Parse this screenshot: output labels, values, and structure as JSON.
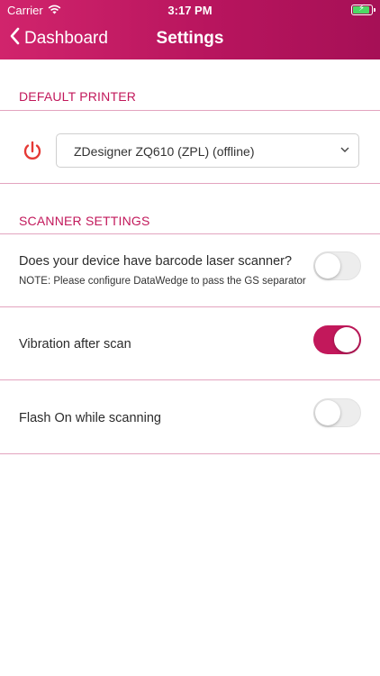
{
  "status_bar": {
    "carrier": "Carrier",
    "time": "3:17 PM",
    "wifi_icon": "wifi-icon",
    "battery_icon": "battery-charging-icon"
  },
  "nav": {
    "back_label": "Dashboard",
    "title": "Settings",
    "back_icon": "chevron-left-icon"
  },
  "printer": {
    "section_title": "DEFAULT PRINTER",
    "selected": "ZDesigner ZQ610 (ZPL) (offline)",
    "status_icon": "power-icon",
    "status_color": "#e53935"
  },
  "scanner": {
    "section_title": "SCANNER SETTINGS",
    "laser_label": "Does your device have barcode laser scanner?",
    "laser_note": "NOTE: Please configure DataWedge to pass the GS separator",
    "laser_enabled": false,
    "vibration_label": "Vibration after scan",
    "vibration_enabled": true,
    "flash_label": "Flash On while scanning",
    "flash_enabled": false
  },
  "colors": {
    "accent": "#c2185b",
    "header_start": "#d1246c",
    "header_end": "#a61056"
  }
}
